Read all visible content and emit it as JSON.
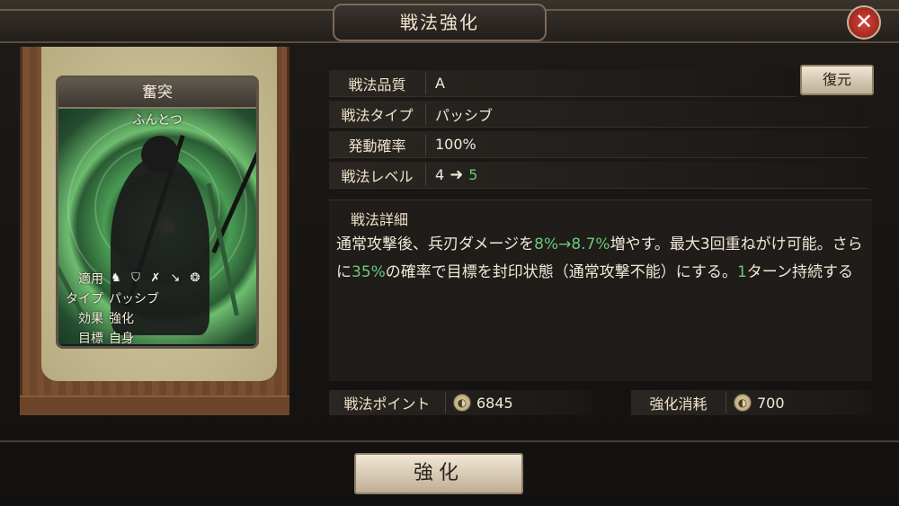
{
  "window": {
    "title": "戦法強化",
    "close_label": "✕"
  },
  "card": {
    "name": "奮突",
    "reading": "ふんとつ",
    "info": [
      {
        "label": "適用",
        "icons": [
          "cavalry-icon",
          "shield-icon",
          "bow-icon",
          "spear-icon",
          "wheel-icon"
        ]
      },
      {
        "label": "タイプ",
        "value": "パッシブ"
      },
      {
        "label": "効果",
        "value": "強化"
      },
      {
        "label": "目標",
        "value": "自身"
      }
    ]
  },
  "stats": {
    "quality_label": "戦法品質",
    "quality_value": "A",
    "type_label": "戦法タイプ",
    "type_value": "パッシブ",
    "rate_label": "発動確率",
    "rate_value": "100%",
    "level_label": "戦法レベル",
    "level_from": "4",
    "level_to": "5"
  },
  "restore_label": "復元",
  "detail": {
    "label": "戦法詳細",
    "p1": "通常攻撃後、兵刃ダメージを",
    "h1": "8%→8.7%",
    "p2": "増やす。最大3回重ねがけ可能。さらに",
    "h2": "35%",
    "p3": "の確率で目標を封印状態（通常攻撃不能）にする。",
    "h3": "1",
    "p4": "ターン持続する"
  },
  "points": {
    "label": "戦法ポイント",
    "value": "6845"
  },
  "cost": {
    "label": "強化消耗",
    "value": "700"
  },
  "enhance_label": "強化",
  "colors": {
    "highlight_green": "#69c97a",
    "close_red": "#c8352b"
  }
}
